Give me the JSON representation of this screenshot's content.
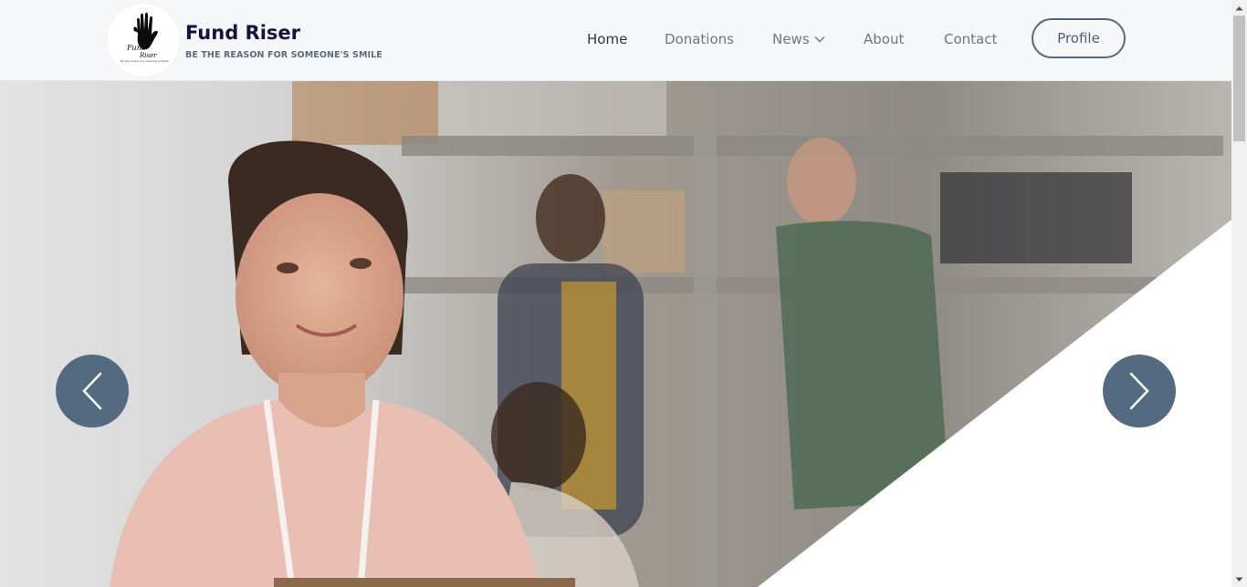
{
  "brand": {
    "title": "Fund Riser",
    "tagline": "BE THE REASON FOR SOMEONE'S SMILE",
    "logo_text_1": "Fund",
    "logo_text_2": "Riser",
    "logo_text_3": "Be the reason for someone's Smile"
  },
  "nav": {
    "items": [
      {
        "label": "Home"
      },
      {
        "label": "Donations"
      },
      {
        "label": "News"
      },
      {
        "label": "About"
      },
      {
        "label": "Contact"
      }
    ],
    "profile_label": "Profile"
  },
  "hero": {
    "prev_icon": "chevron-left-icon",
    "next_icon": "chevron-right-icon"
  },
  "colors": {
    "brand_navy": "#14123f",
    "button_slate": "#536a80",
    "header_bg": "#f5f7f9"
  }
}
